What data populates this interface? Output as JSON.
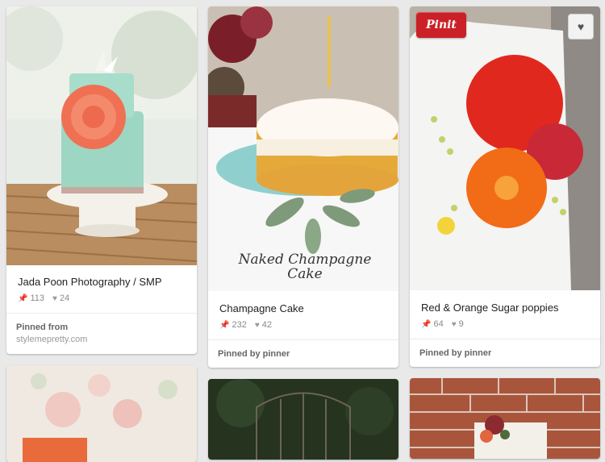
{
  "pins": [
    {
      "title": "Jada Poon Photography / SMP",
      "repins": "113",
      "likes": "24",
      "pinned_label": "Pinned from",
      "source": "stylemepretty.com"
    },
    {
      "title": "Champagne Cake",
      "repins": "232",
      "likes": "42",
      "pinned_label": "Pinned by pinner",
      "caption_line1": "Naked Champagne",
      "caption_line2": "Cake"
    },
    {
      "title": "Red & Orange Sugar poppies",
      "repins": "64",
      "likes": "9",
      "pinned_label": "Pinned by pinner",
      "pinit_label": "Pinit"
    }
  ],
  "icons": {
    "repin": "pin-icon",
    "like": "heart-icon"
  },
  "colors": {
    "background": "#e9e9e9",
    "pinit_red": "#cb2027"
  }
}
